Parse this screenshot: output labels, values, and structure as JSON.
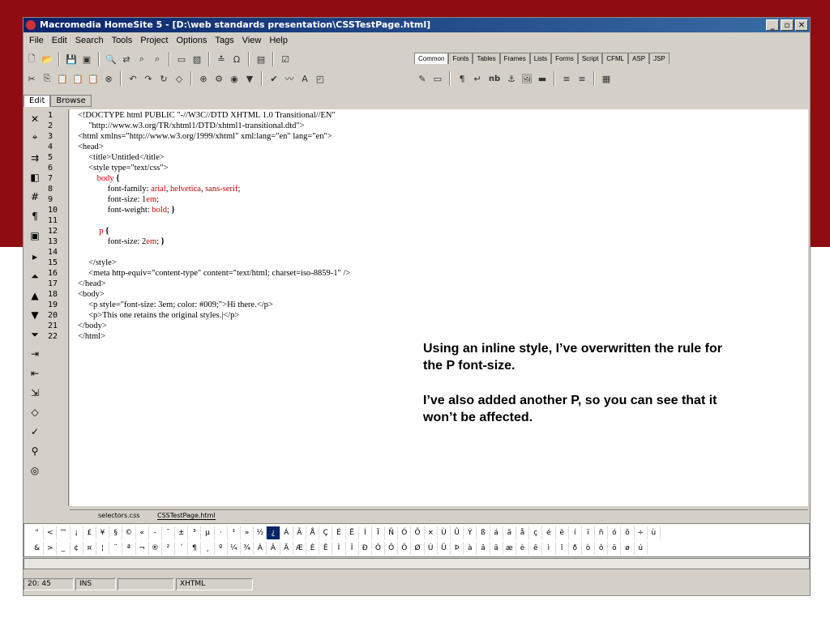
{
  "window": {
    "title": "Macromedia HomeSite 5 - [D:\\web standards presentation\\CSSTestPage.html]"
  },
  "menu": [
    "File",
    "Edit",
    "Search",
    "Tools",
    "Project",
    "Options",
    "Tags",
    "View",
    "Help"
  ],
  "tag_tabs": [
    "Common",
    "Fonts",
    "Tables",
    "Frames",
    "Lists",
    "Forms",
    "Script",
    "CFML",
    "ASP",
    "JSP"
  ],
  "edit_tabs": [
    "Edit",
    "Browse"
  ],
  "line_numbers": [
    "1",
    "2",
    "3",
    "4",
    "5",
    "6",
    "7",
    "8",
    "9",
    "10",
    "11",
    "12",
    "13",
    "14",
    "15",
    "16",
    "17",
    "18",
    "19",
    "20",
    "21",
    "22"
  ],
  "notes": {
    "para1": "Using an inline style, I’ve overwritten the rule for the P font-size.",
    "para2": "I’ve also added another P, so you can see that it won’t be affected."
  },
  "file_tabs": [
    "selectors.css",
    "CSSTestPage.html"
  ],
  "charmap_row1": [
    "\"",
    "<",
    "™",
    "¡",
    "£",
    "¥",
    "§",
    "©",
    "«",
    "-",
    "¯",
    "±",
    "³",
    "µ",
    "·",
    "¹",
    "»",
    "½",
    "¿",
    "Á",
    "Ã",
    "Å",
    "Ç",
    "É",
    "Ë",
    "Í",
    "Ï",
    "Ñ",
    "Ó",
    "Õ",
    "×",
    "Ù",
    "Û",
    "Ý",
    "ß",
    "á",
    "ã",
    "å",
    "ç",
    "é",
    "ë",
    "í",
    "ï",
    "ñ",
    "ó",
    "õ",
    "÷",
    "ù"
  ],
  "charmap_row2": [
    "&",
    ">",
    "_",
    "¢",
    "¤",
    "¦",
    "¨",
    "ª",
    "¬",
    "®",
    "²",
    "´",
    "¶",
    "¸",
    "º",
    "¼",
    "¾",
    "À",
    "Â",
    "Ä",
    "Æ",
    "È",
    "Ê",
    "Ì",
    "Î",
    "Ð",
    "Ò",
    "Ô",
    "Ö",
    "Ø",
    "Ú",
    "Ü",
    "Þ",
    "à",
    "â",
    "ä",
    "æ",
    "è",
    "ê",
    "ì",
    "î",
    "ð",
    "ò",
    "ô",
    "ö",
    "ø",
    "ú"
  ],
  "status": {
    "position": "20: 45",
    "mode": "INS",
    "doc_type": "XHTML"
  }
}
